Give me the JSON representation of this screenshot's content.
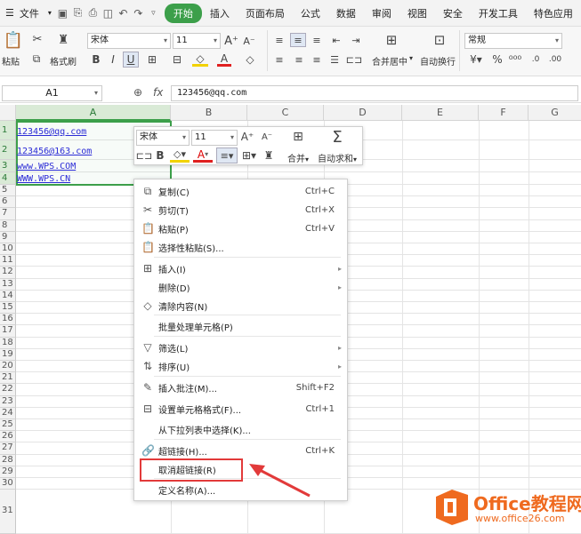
{
  "menubar": {
    "file_label": "文件",
    "tabs": [
      "开始",
      "插入",
      "页面布局",
      "公式",
      "数据",
      "审阅",
      "视图",
      "安全",
      "开发工具",
      "特色应用"
    ],
    "active_tab": "开始"
  },
  "ribbon": {
    "paste": "粘贴",
    "format_painter": "格式刷",
    "font_name": "宋体",
    "font_size": "11",
    "merge_center": "合并居中",
    "wrap_text": "自动换行",
    "number_format": "常规"
  },
  "formula_bar": {
    "name_box": "A1",
    "fx": "fx",
    "content": "123456@qq.com"
  },
  "columns": [
    "A",
    "B",
    "C",
    "D",
    "E",
    "F",
    "G"
  ],
  "rows": [
    "1",
    "2",
    "3",
    "4",
    "5",
    "6",
    "7",
    "8",
    "9",
    "10",
    "11",
    "12",
    "13",
    "14",
    "15",
    "16",
    "17",
    "18",
    "19",
    "20",
    "21",
    "22",
    "23",
    "24",
    "25",
    "26",
    "27",
    "28",
    "29",
    "30",
    "31"
  ],
  "cells": [
    "123456@qq.com",
    "123456@163.com",
    "www.WPS.COM",
    "WWW.WPS.CN"
  ],
  "mini_toolbar": {
    "font_name": "宋体",
    "font_size": "11",
    "merge": "合并",
    "autosum": "自动求和",
    "bold": "B",
    "text_color_letter": "A"
  },
  "context_menu": {
    "items": [
      {
        "label": "复制(C)",
        "shortcut": "Ctrl+C",
        "icon": "copy-icon"
      },
      {
        "label": "剪切(T)",
        "shortcut": "Ctrl+X",
        "icon": "cut-icon"
      },
      {
        "label": "粘贴(P)",
        "shortcut": "Ctrl+V",
        "icon": "paste-icon"
      },
      {
        "label": "选择性粘贴(S)...",
        "shortcut": "",
        "icon": "paste-special-icon"
      },
      {
        "label": "插入(I)",
        "shortcut": "",
        "icon": "insert-icon"
      },
      {
        "label": "删除(D)",
        "shortcut": "",
        "icon": ""
      },
      {
        "label": "清除内容(N)",
        "shortcut": "",
        "icon": "eraser-icon"
      },
      {
        "label": "批量处理单元格(P)",
        "shortcut": "",
        "icon": ""
      },
      {
        "label": "筛选(L)",
        "shortcut": "",
        "icon": "filter-icon"
      },
      {
        "label": "排序(U)",
        "shortcut": "",
        "icon": "sort-icon"
      },
      {
        "label": "插入批注(M)...",
        "shortcut": "Shift+F2",
        "icon": "comment-icon"
      },
      {
        "label": "设置单元格格式(F)...",
        "shortcut": "Ctrl+1",
        "icon": "format-cells-icon"
      },
      {
        "label": "从下拉列表中选择(K)...",
        "shortcut": "",
        "icon": ""
      },
      {
        "label": "超链接(H)...",
        "shortcut": "Ctrl+K",
        "icon": "link-icon"
      },
      {
        "label": "取消超链接(R)",
        "shortcut": "",
        "icon": ""
      },
      {
        "label": "定义名称(A)...",
        "shortcut": "",
        "icon": ""
      }
    ]
  },
  "watermark": {
    "brand": "Office教程网",
    "url": "www.office26.com"
  },
  "colors": {
    "accent_green": "#3c9f4a",
    "highlight_red": "#e23a3a",
    "link_blue": "#2b2bd6",
    "logo_orange": "#ef6a1f"
  }
}
